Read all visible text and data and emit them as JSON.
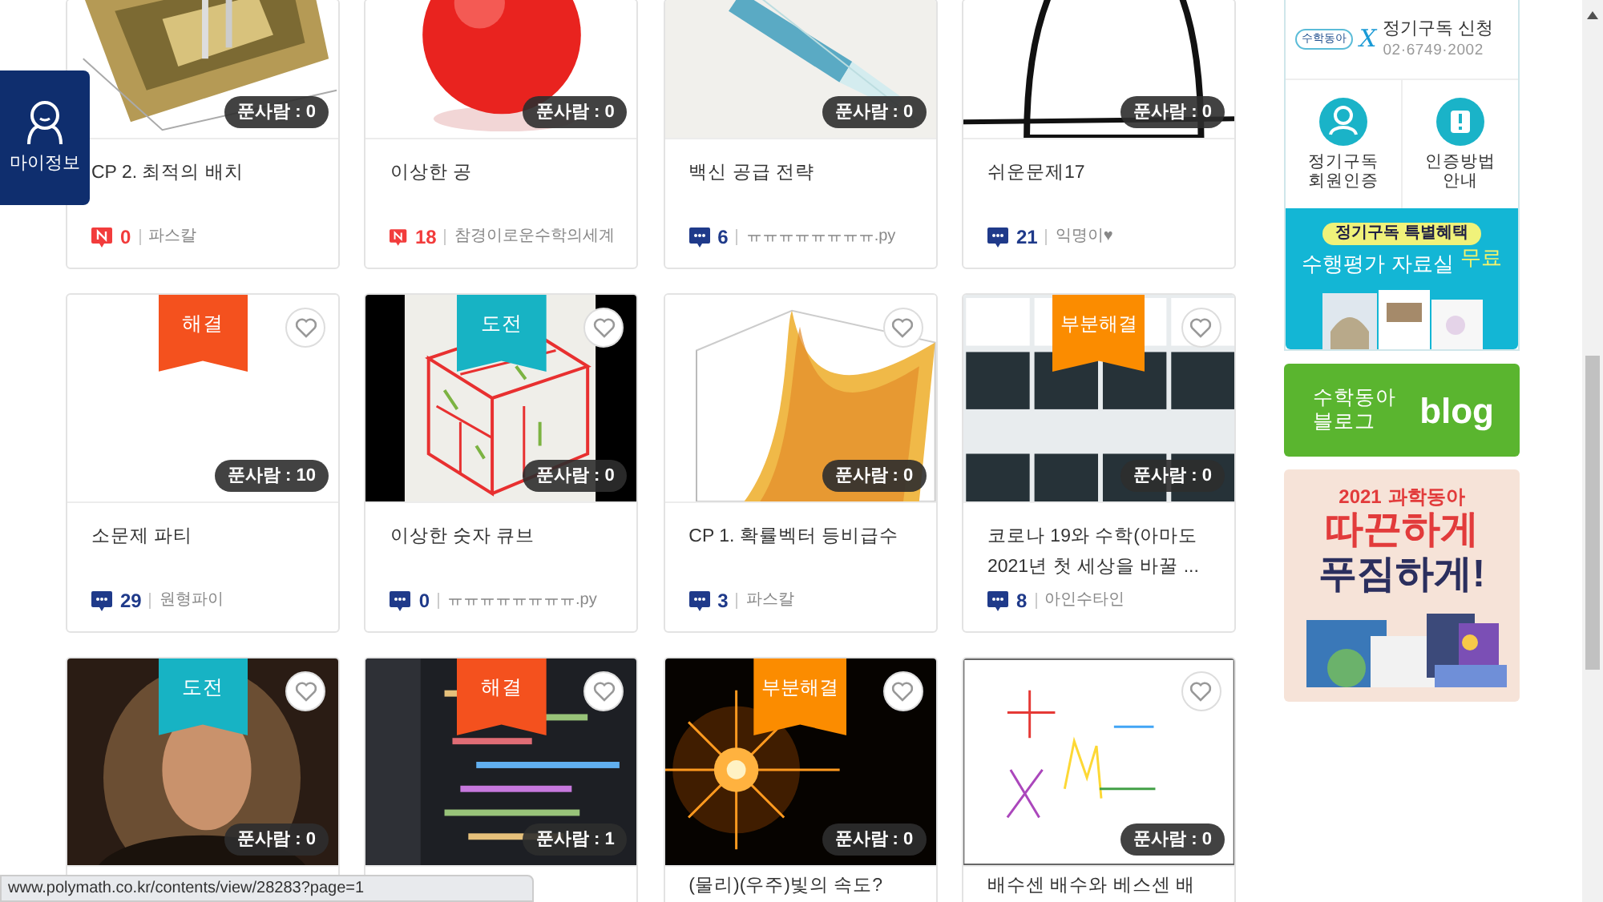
{
  "floating_button": {
    "label": "마이정보"
  },
  "cards": [
    {
      "title": "CP 2. 최적의 배치",
      "viewers": "푼사람 : 0",
      "new": true,
      "comments": "0",
      "author": "파스칼"
    },
    {
      "title": "이상한 공",
      "viewers": "푼사람 : 0",
      "new": true,
      "comments": "18",
      "author": "참경이로운수학의세계"
    },
    {
      "title": "백신 공급 전략",
      "viewers": "푼사람 : 0",
      "new": false,
      "comments": "6",
      "author": "ㅠㅠㅠㅠㅠㅠㅠㅠ.py"
    },
    {
      "title": "쉬운문제17",
      "viewers": "푼사람 : 0",
      "new": false,
      "comments": "21",
      "author": "익명이♥"
    },
    {
      "title": "소문제 파티",
      "viewers": "푼사람 : 10",
      "badge": {
        "kind": "solved",
        "label": "해결"
      },
      "favorite": false,
      "new": false,
      "comments": "29",
      "author": "원형파이"
    },
    {
      "title": "이상한 숫자 큐브",
      "viewers": "푼사람 : 0",
      "badge": {
        "kind": "challenge",
        "label": "도전"
      },
      "favorite": false,
      "new": false,
      "comments": "0",
      "author": "ㅠㅠㅠㅠㅠㅠㅠㅠ.py"
    },
    {
      "title": "CP 1. 확률벡터 등비급수",
      "viewers": "푼사람 : 0",
      "favorite": false,
      "new": false,
      "comments": "3",
      "author": "파스칼"
    },
    {
      "title": "코로나 19와 수학(아마도 2021년 첫 세상을 바꿀 ...",
      "viewers": "푼사람 : 0",
      "badge": {
        "kind": "partial",
        "label": "부분해결"
      },
      "favorite": false,
      "new": false,
      "comments": "8",
      "author": "아인수타인"
    },
    {
      "viewers": "푼사람 : 0",
      "badge": {
        "kind": "challenge",
        "label": "도전"
      },
      "favorite": false
    },
    {
      "viewers": "푼사람 : 1",
      "badge": {
        "kind": "solved",
        "label": "해결"
      },
      "favorite": false
    },
    {
      "title": "(물리)(우주)빛의 속도?",
      "viewers": "푼사람 : 0",
      "badge": {
        "kind": "partial",
        "label": "부분해결"
      },
      "favorite": false
    },
    {
      "title": "배수센 배수와 베스센 배",
      "viewers": "푼사람 : 0",
      "favorite": false
    }
  ],
  "sidebar": {
    "subscribe": {
      "logo": "수학동아",
      "logo_mark": "X",
      "title": "정기구독 신청",
      "phone": "02·6749·2002"
    },
    "links": [
      {
        "kind": "member",
        "label": "정기구독\n회원인증"
      },
      {
        "kind": "guide",
        "label": "인증방법\n안내"
      }
    ],
    "benefit_banner": {
      "tag": "정기구독 특별혜택",
      "headline": "수행평가 자료실",
      "highlight": "무료"
    },
    "blog_banner": {
      "label": "수학동아\n블로그",
      "logo": "blog"
    },
    "ad_banner": {
      "year": "2021",
      "brand": "과학동아",
      "line_1": "따끈하게",
      "line_2": "푸짐하게!"
    }
  },
  "status_bar": {
    "url": "www.polymath.co.kr/contents/view/28283?page=1"
  }
}
